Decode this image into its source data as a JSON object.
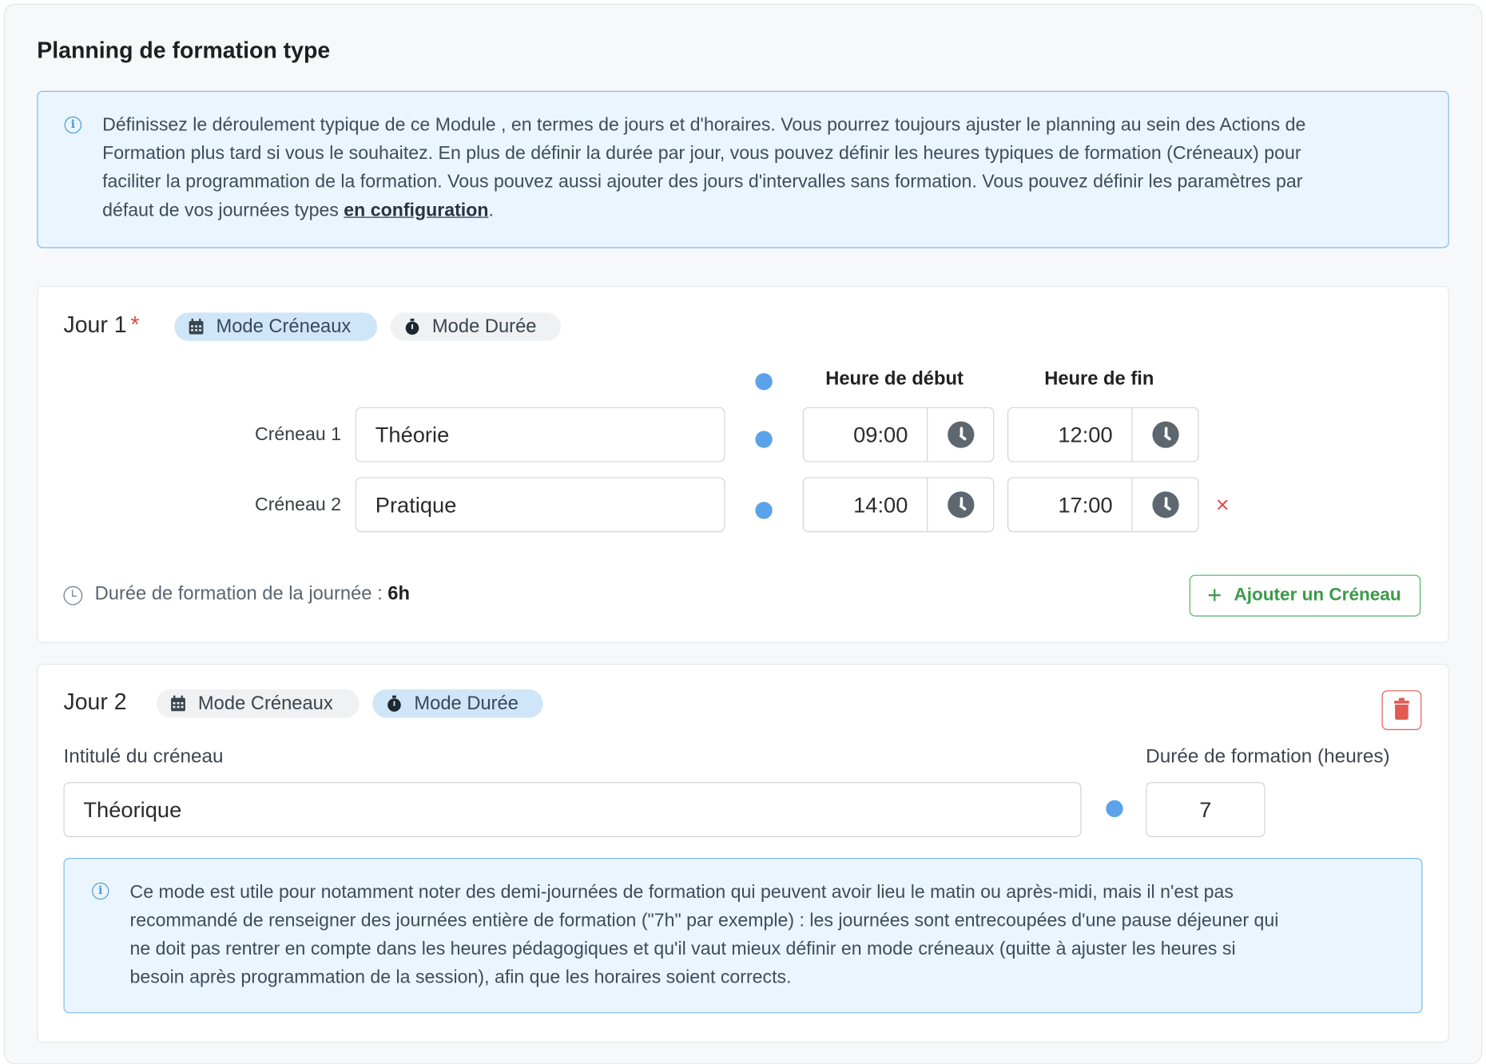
{
  "page": {
    "title": "Planning de formation type"
  },
  "intro_info": {
    "icon": "info-icon",
    "lines": [
      "Définissez le déroulement typique de ce Module , en termes de jours et d'horaires. Vous pourrez toujours ajuster le planning au sein des Actions de",
      "Formation plus tard si vous le souhaitez. En plus de définir la durée par jour, vous pouvez définir les heures typiques de formation (Créneaux) pour",
      "faciliter la programmation de la formation. Vous pouvez aussi ajouter des jours d'intervalles sans formation. Vous pouvez définir les paramètres par"
    ],
    "last_line_prefix": "défaut de vos journées types ",
    "link": "en configuration",
    "last_line_suffix": "."
  },
  "day1": {
    "label": "Jour 1",
    "required_mark": "*",
    "mode_slots": "Mode Créneaux",
    "mode_duration": "Mode Durée",
    "active_mode": "slots",
    "col_start": "Heure de début",
    "col_end": "Heure de fin",
    "slots": [
      {
        "label": "Créneau 1",
        "name": "Théorie",
        "start": "09:00",
        "end": "12:00"
      },
      {
        "label": "Créneau 2",
        "name": "Pratique",
        "start": "14:00",
        "end": "17:00"
      }
    ],
    "remove_symbol": "×",
    "duration_label": "Durée de formation de la journée : ",
    "duration_value": "6h",
    "add_slot": "Ajouter un Créneau",
    "add_symbol": "+"
  },
  "day2": {
    "label": "Jour 2",
    "mode_slots": "Mode Créneaux",
    "mode_duration": "Mode Durée",
    "active_mode": "duration",
    "slot_title_label": "Intitulé du créneau",
    "slot_title_value": "Théorique",
    "duration_hours_label": "Durée de formation (heures)",
    "duration_hours_value": "7",
    "info_lines": [
      "Ce mode est utile pour notamment noter des demi-journées de formation qui peuvent avoir lieu le matin ou après-midi, mais il n'est pas",
      "recommandé de renseigner des journées entière de formation (\"7h\" par exemple) : les journées sont entrecoupées d'une pause déjeuner qui",
      "ne doit pas rentrer en compte dans les heures pédagogiques et qu'il vaut mieux définir en mode créneaux (quitte à ajuster les heures si",
      "besoin après programmation de la session), afin que les horaires soient corrects."
    ]
  },
  "colors": {
    "accent_blue": "#5ba2e8",
    "info_bg": "#eaf5fd",
    "add_green": "#3a9a48",
    "danger_red": "#e25a54"
  }
}
